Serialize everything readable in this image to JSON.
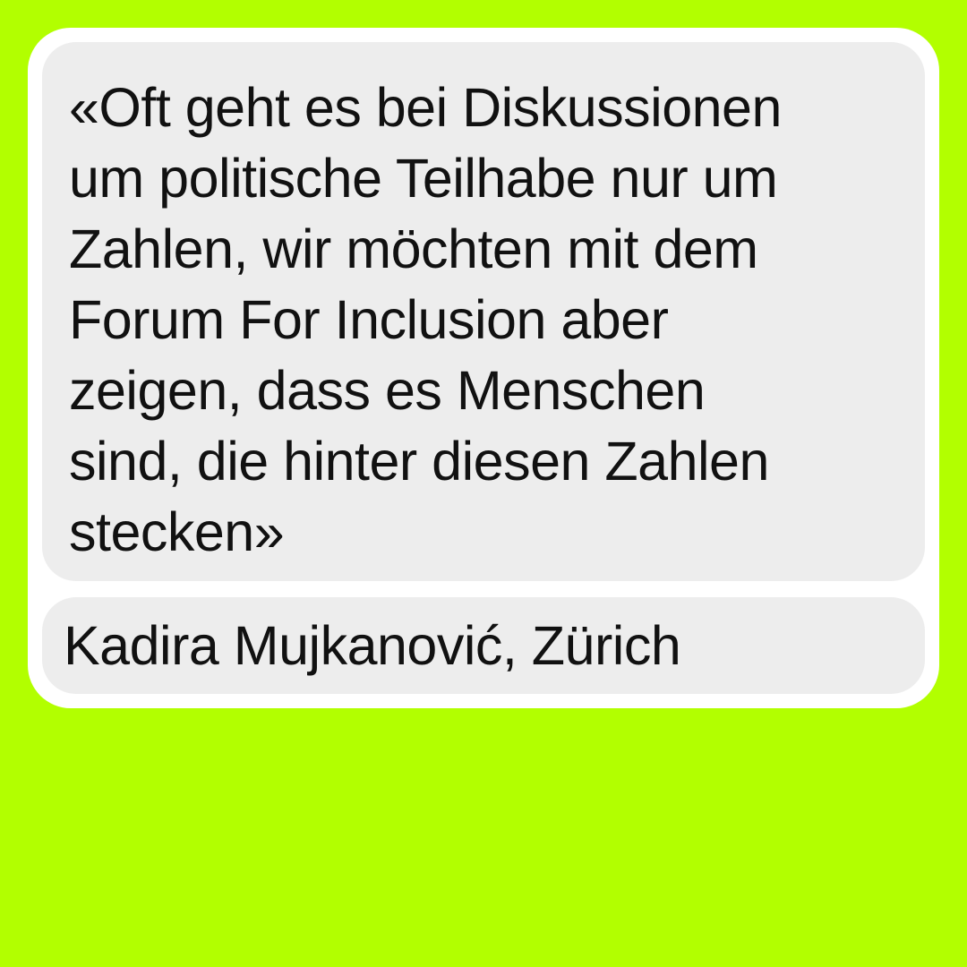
{
  "colors": {
    "background": "#b2ff00",
    "card": "#ffffff",
    "panel": "#ededed",
    "text": "#111111"
  },
  "quote": {
    "lines": [
      "«Oft geht es bei Diskussionen",
      "um politische Teilhabe nur um",
      "Zahlen, wir möchten mit dem",
      "Forum For Inclusion aber",
      "zeigen, dass es Menschen",
      "sind, die hinter diesen Zahlen",
      "stecken»"
    ]
  },
  "attribution": {
    "text": "Kadira Mujkanović, Zürich"
  }
}
